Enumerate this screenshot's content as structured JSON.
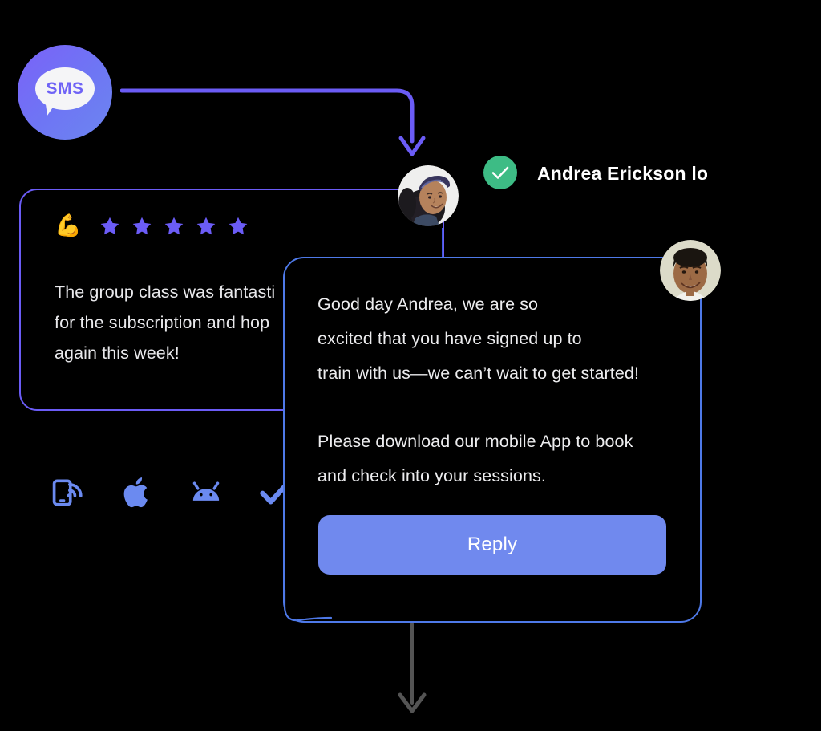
{
  "colors": {
    "background": "#000000",
    "purple_accent": "#6B5CF6",
    "blue_border": "#4E79E8",
    "reply_button": "#7089EE",
    "icon_blue": "#6B8AF0",
    "green_check": "#3DBC85",
    "gray_arrow": "#545454",
    "text_light": "#ECECEE"
  },
  "sms_badge": {
    "label": "SMS",
    "icon": "sms-chat-bubble-icon"
  },
  "flow": {
    "top_arrow_icon": "elbow-arrow-down-icon",
    "bottom_arrow_icon": "arrow-down-icon"
  },
  "status": {
    "check_icon": "green-check-circle-icon",
    "text": "Andrea Erickson logs"
  },
  "review": {
    "emoji": "💪",
    "emoji_name": "flexed-biceps-emoji",
    "stars": 5,
    "star_icon": "star-filled-icon",
    "lines": [
      "The group class was fantasti",
      "for the subscription and hop",
      "again this week!"
    ]
  },
  "platform_icons": [
    {
      "name": "mobile-signal-icon",
      "label": "Mobile"
    },
    {
      "name": "apple-logo-icon",
      "label": "Apple"
    },
    {
      "name": "android-logo-icon",
      "label": "Android"
    },
    {
      "name": "checkmark-icon",
      "label": "Check"
    }
  ],
  "chat": {
    "paragraph_1": [
      "Good day Andrea, we are so",
      "excited that you have signed up to",
      "train with us—we can’t wait to get started!"
    ],
    "paragraph_2": [
      "Please download our mobile App to book",
      "and check into your sessions."
    ],
    "reply_label": "Reply"
  },
  "avatars": {
    "woman": "avatar-andrea-erickson",
    "man": "avatar-trainer"
  }
}
